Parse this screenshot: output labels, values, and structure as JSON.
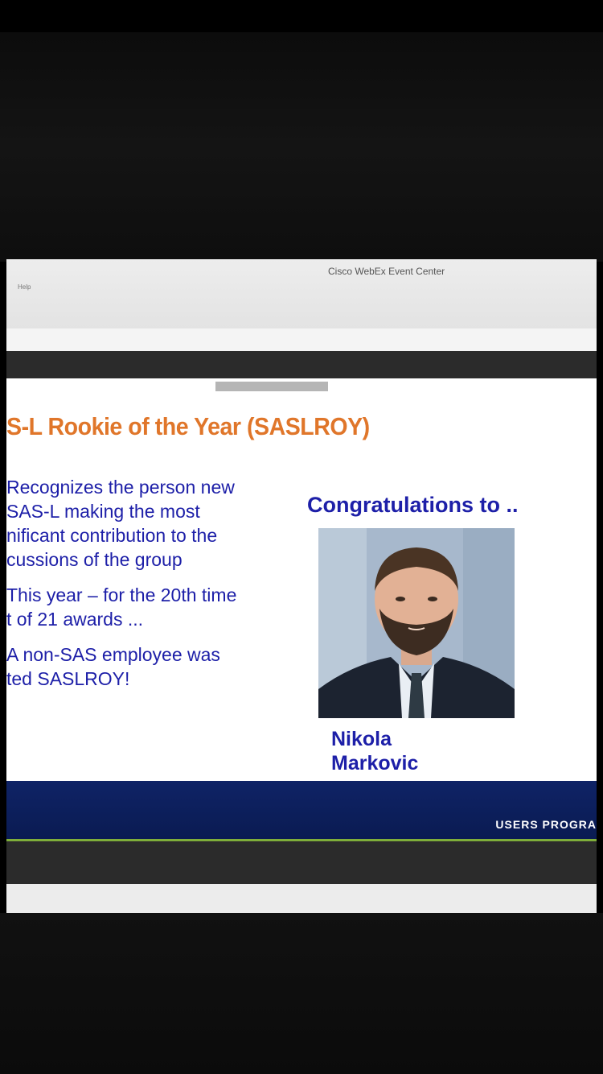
{
  "window": {
    "title": "Cisco WebEx Event Center",
    "menu_item": "Help"
  },
  "slide": {
    "title": "S-L Rookie of the Year (SASLROY)",
    "bullets": [
      "Recognizes the person new",
      "SAS-L making the most",
      "nificant contribution to the",
      "cussions of the group",
      "This year – for the 20th time",
      "t of 21 awards ...",
      "A non-SAS employee was",
      "ted SASLROY!"
    ],
    "congrats": "Congratulations to ..",
    "name_first": "Nikola",
    "name_last": "Markovic",
    "footer": "USERS PROGRA"
  },
  "colors": {
    "title_orange": "#e0762a",
    "text_blue": "#1d1fa8",
    "footer_navy": "#0f2366",
    "accent_green": "#7fae3a"
  }
}
